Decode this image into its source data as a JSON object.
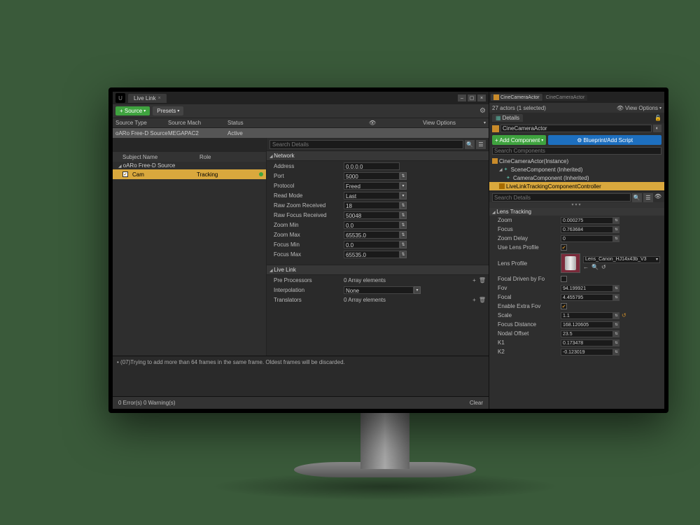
{
  "left": {
    "tab_title": "Live Link",
    "source_btn": "+ Source",
    "presets_btn": "Presets",
    "headers": {
      "type": "Source Type",
      "machine": "Source Mach",
      "status": "Status"
    },
    "view_options": "View Options",
    "source": {
      "type": "oARo Free-D Source",
      "machine": "MEGAPAC2",
      "status": "Active"
    },
    "subj_headers": {
      "name": "Subject Name",
      "role": "Role"
    },
    "subj_group": "oARo Free-D Source",
    "subj_item": {
      "name": "Cam",
      "role": "Tracking"
    },
    "search_ph": "Search Details",
    "sections": {
      "network": "Network",
      "livelink": "Live Link"
    },
    "network": {
      "address": {
        "lbl": "Address",
        "val": "0.0.0.0"
      },
      "port": {
        "lbl": "Port",
        "val": "5000"
      },
      "protocol": {
        "lbl": "Protocol",
        "val": "Freed"
      },
      "readmode": {
        "lbl": "Read Mode",
        "val": "Last"
      },
      "rawzoom": {
        "lbl": "Raw Zoom Received",
        "val": "18"
      },
      "rawfocus": {
        "lbl": "Raw Focus Received",
        "val": "50048"
      },
      "zoommin": {
        "lbl": "Zoom Min",
        "val": "0.0"
      },
      "zoommax": {
        "lbl": "Zoom Max",
        "val": "65535.0"
      },
      "focusmin": {
        "lbl": "Focus Min",
        "val": "0.0"
      },
      "focusmax": {
        "lbl": "Focus Max",
        "val": "65535.0"
      }
    },
    "livelink": {
      "pre": {
        "lbl": "Pre Processors",
        "val": "0 Array elements"
      },
      "interp": {
        "lbl": "Interpolation",
        "val": "None"
      },
      "trans": {
        "lbl": "Translators",
        "val": "0 Array elements"
      }
    },
    "log": "• (07)Trying to add more than 64 frames in the same frame. Oldest frames will be discarded.",
    "status": {
      "left": "0 Error(s)  0 Warning(s)",
      "clear": "Clear"
    }
  },
  "right": {
    "tabs": {
      "active": "CineCameraActor",
      "inactive": "CineCameraActor"
    },
    "actors": "27 actors (1 selected)",
    "view_options": "View Options",
    "details_tab": "Details",
    "actor_name": "CineCameraActor",
    "add_comp": "+ Add Component",
    "blueprint": "Blueprint/Add Script",
    "search_comp_ph": "Search Components",
    "tree": {
      "root": "CineCameraActor(Instance)",
      "scene": "SceneComponent (Inherited)",
      "camera": "CameraComponent (Inherited)",
      "controller": "LiveLinkTrackingComponentController"
    },
    "search_det_ph": "Search Details",
    "section": "Lens Tracking",
    "props": {
      "zoom": {
        "lbl": "Zoom",
        "val": "0.000275"
      },
      "focus": {
        "lbl": "Focus",
        "val": "0.763684"
      },
      "zoomdelay": {
        "lbl": "Zoom Delay",
        "val": "0"
      },
      "uselens": {
        "lbl": "Use Lens Profile"
      },
      "lensprofile": {
        "lbl": "Lens Profile",
        "val": "Lens_Canon_HJ14x43b_V3"
      },
      "focaldriven": {
        "lbl": "Focal Driven by Fo"
      },
      "fov": {
        "lbl": "Fov",
        "val": "94.199921"
      },
      "focal": {
        "lbl": "Focal",
        "val": "4.455795"
      },
      "extrafov": {
        "lbl": "Enable Extra Fov"
      },
      "scale": {
        "lbl": "Scale",
        "val": "1.1"
      },
      "focusdist": {
        "lbl": "Focus Distance",
        "val": "168.120605"
      },
      "nodal": {
        "lbl": "Nodal Offset",
        "val": "23.5"
      },
      "k1": {
        "lbl": "K1",
        "val": "0.173478"
      },
      "k2": {
        "lbl": "K2",
        "val": "-0.123019"
      }
    }
  }
}
